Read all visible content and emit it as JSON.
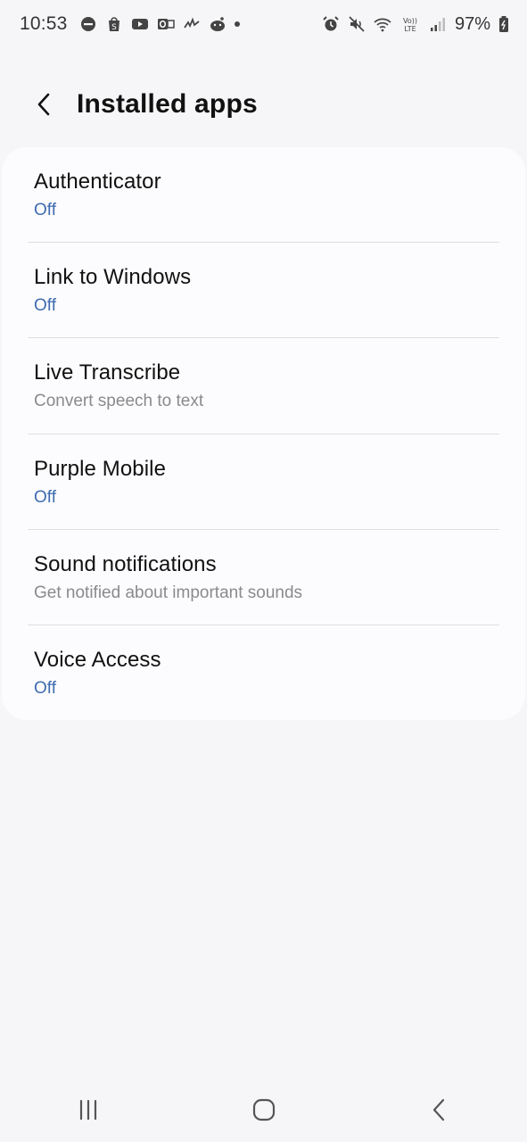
{
  "status_bar": {
    "time": "10:53",
    "battery": "97%",
    "left_icons": [
      "do-not-disturb-icon",
      "shopping-icon",
      "youtube-icon",
      "outlook-icon",
      "activity-icon",
      "reddit-icon",
      "more-dot-icon"
    ],
    "right_icons": [
      "alarm-icon",
      "mute-icon",
      "wifi-icon",
      "volte-icon",
      "signal-icon",
      "battery-icon"
    ],
    "volte_label": "Vo)) LTE"
  },
  "header": {
    "title": "Installed apps",
    "back_icon": "chevron-left-icon"
  },
  "apps": [
    {
      "name": "Authenticator",
      "subtitle": "Off",
      "kind": "status"
    },
    {
      "name": "Link to Windows",
      "subtitle": "Off",
      "kind": "status"
    },
    {
      "name": "Live Transcribe",
      "subtitle": "Convert speech to text",
      "kind": "desc"
    },
    {
      "name": "Purple Mobile",
      "subtitle": "Off",
      "kind": "status"
    },
    {
      "name": "Sound notifications",
      "subtitle": "Get notified about important sounds",
      "kind": "desc"
    },
    {
      "name": "Voice Access",
      "subtitle": "Off",
      "kind": "status"
    }
  ],
  "nav_bar": {
    "items": [
      "recent-apps-icon",
      "home-icon",
      "back-icon"
    ]
  },
  "colors": {
    "background": "#f6f6f8",
    "card": "#fcfcfe",
    "status_accent": "#3e6bb0",
    "secondary_text": "#8a8a8e"
  }
}
